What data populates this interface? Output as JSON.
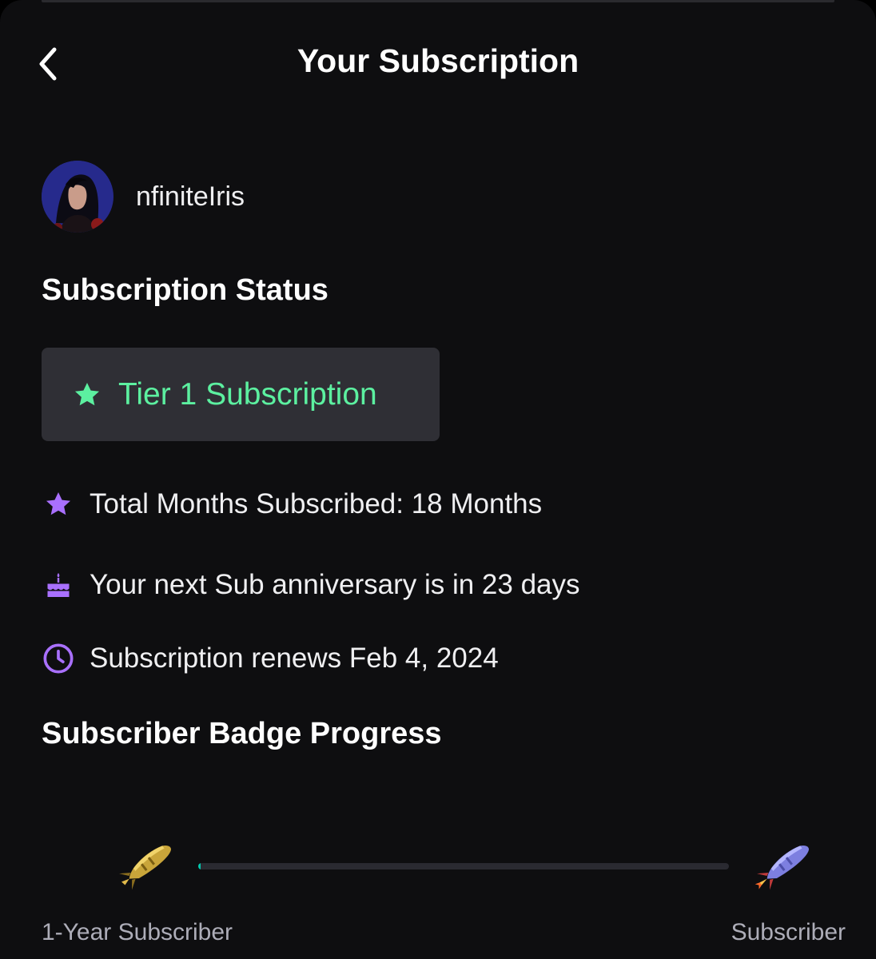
{
  "header": {
    "title": "Your Subscription",
    "back_icon": "chevron-left-icon"
  },
  "channel": {
    "name": "nfiniteIris"
  },
  "subscription_status": {
    "heading": "Subscription Status",
    "tier_label": "Tier 1 Subscription",
    "tier_icon": "star-icon",
    "tier_color": "#5cf0a0"
  },
  "details": [
    {
      "icon": "star-icon",
      "text": "Total Months Subscribed: 18 Months"
    },
    {
      "icon": "cake-icon",
      "text": "Your next Sub anniversary is in 23 days"
    },
    {
      "icon": "clock-icon",
      "text": "Subscription renews Feb 4, 2024"
    }
  ],
  "badge_progress": {
    "heading": "Subscriber Badge Progress",
    "current_badge_label": "1-Year Subscriber",
    "next_badge_label": "Subscriber",
    "current_badge_icon": "gold-rocket-icon",
    "next_badge_icon": "purple-rocket-icon",
    "progress_fraction": 0.004
  },
  "colors": {
    "background": "#0e0e10",
    "accent_purple": "#9147ff",
    "accent_green": "#5cf0a0",
    "tier_box": "#2f2f35"
  }
}
